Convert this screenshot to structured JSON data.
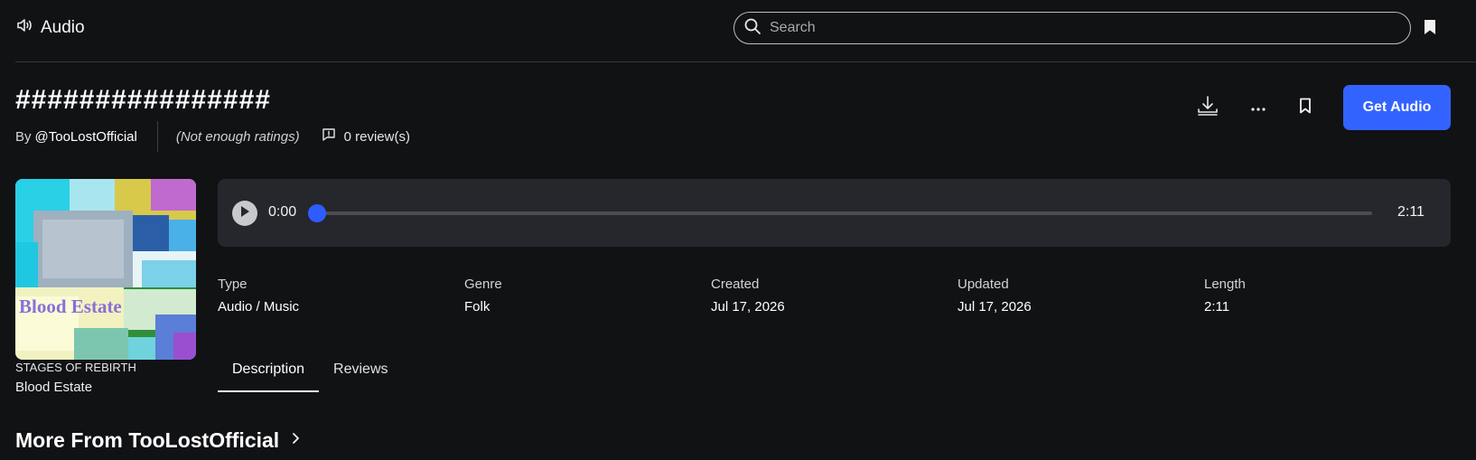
{
  "header": {
    "app_title": "Audio",
    "search": {
      "placeholder": "Search",
      "value": ""
    },
    "icons": {
      "brand": "speaker-icon",
      "search": "search-icon",
      "bookmark": "bookmark-icon"
    }
  },
  "asset": {
    "title": "################",
    "by_label": "By",
    "creator": "@TooLostOfficial",
    "ratings_text": "(Not enough ratings)",
    "reviews_text": "0 review(s)"
  },
  "actions": {
    "get_label": "Get Audio",
    "icons": [
      "download-icon",
      "more-icon",
      "bookmark-icon"
    ]
  },
  "cover": {
    "art_text": "Blood Estate",
    "subtitle": "STAGES OF REBIRTH",
    "title": "Blood Estate"
  },
  "player": {
    "current_time": "0:00",
    "total_time": "2:11",
    "progress": 0
  },
  "details": [
    {
      "key": "Type",
      "value": "Audio / Music"
    },
    {
      "key": "Genre",
      "value": "Folk"
    },
    {
      "key": "Created",
      "value": "Jul 17, 2026"
    },
    {
      "key": "Updated",
      "value": "Jul 17, 2026"
    },
    {
      "key": "Length",
      "value": "2:11"
    }
  ],
  "tabs": [
    {
      "label": "Description",
      "active": true
    },
    {
      "label": "Reviews",
      "active": false
    }
  ],
  "more_section": {
    "title": "More From TooLostOfficial"
  },
  "colors": {
    "accent": "#3363ff",
    "background": "#111214",
    "panel": "#25272d"
  }
}
